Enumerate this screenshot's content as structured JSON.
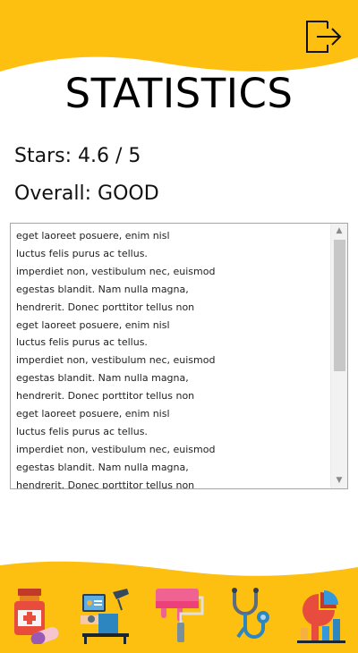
{
  "header": {
    "title": "STATISTICS",
    "logout_icon": "logout-icon"
  },
  "stats": {
    "stars_text": "Stars: 4.6 / 5",
    "overall_text": "Overall: GOOD"
  },
  "comments": {
    "lines": [
      "eget laoreet posuere, enim nisl",
      "luctus felis purus ac tellus.",
      "imperdiet non, vestibulum nec, euismod",
      "egestas blandit. Nam nulla magna,",
      "hendrerit. Donec porttitor tellus non",
      "eget laoreet posuere, enim nisl",
      "luctus felis purus ac tellus.",
      "imperdiet non, vestibulum nec, euismod",
      "egestas blandit. Nam nulla magna,",
      "hendrerit. Donec porttitor tellus non",
      "eget laoreet posuere, enim nisl",
      "luctus felis purus ac tellus.",
      "imperdiet non, vestibulum nec, euismod",
      "egestas blandit. Nam nulla magna,",
      "hendrerit. Donec porttitor tellus non"
    ],
    "scroll_up_glyph": "▲",
    "scroll_down_glyph": "▼"
  },
  "bottom_nav": {
    "items": [
      {
        "icon": "medicine-icon"
      },
      {
        "icon": "office-work-icon"
      },
      {
        "icon": "paint-roller-icon"
      },
      {
        "icon": "stethoscope-icon"
      },
      {
        "icon": "statistics-chart-icon"
      }
    ]
  },
  "colors": {
    "accent": "#FDBF10",
    "background": "#FFFFFF"
  }
}
